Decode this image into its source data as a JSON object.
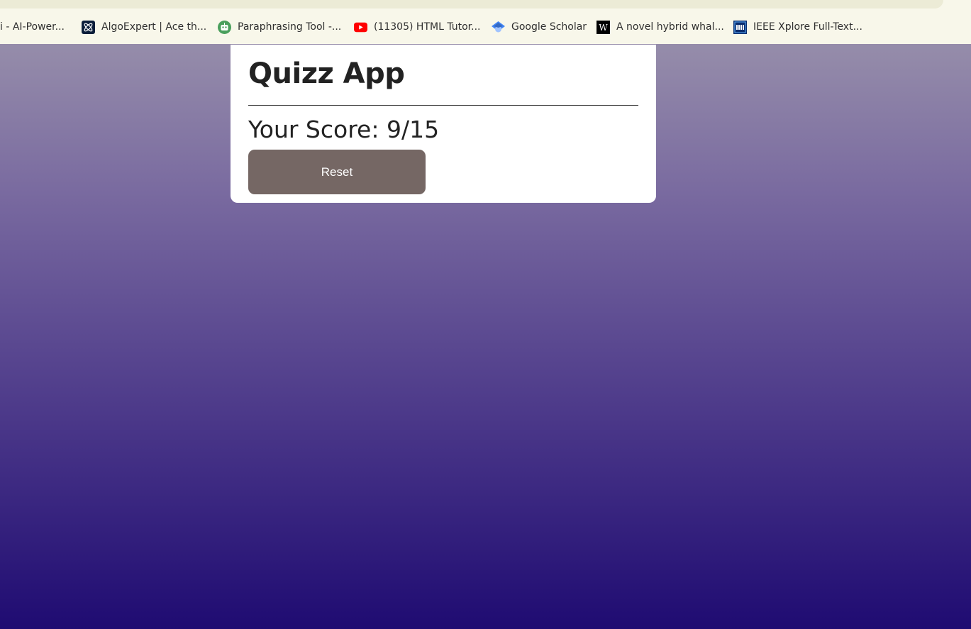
{
  "bookmarks": [
    {
      "label": "i - AI-Power...",
      "icon": "none"
    },
    {
      "label": "AlgoExpert | Ace th...",
      "icon": "algoexpert-icon"
    },
    {
      "label": "Paraphrasing Tool -...",
      "icon": "robot-icon"
    },
    {
      "label": "(11305) HTML Tutor...",
      "icon": "youtube-icon"
    },
    {
      "label": "Google Scholar",
      "icon": "scholar-icon"
    },
    {
      "label": "A novel hybrid whal...",
      "icon": "wiley-icon"
    },
    {
      "label": "IEEE Xplore Full-Text...",
      "icon": "ieee-icon"
    }
  ],
  "quiz": {
    "title": "Quizz App",
    "score_text": "Your Score: 9/15",
    "reset_label": "Reset"
  },
  "colors": {
    "button": "#756764",
    "background_top": "#9e97ad",
    "background_bottom": "#1f0b72"
  }
}
